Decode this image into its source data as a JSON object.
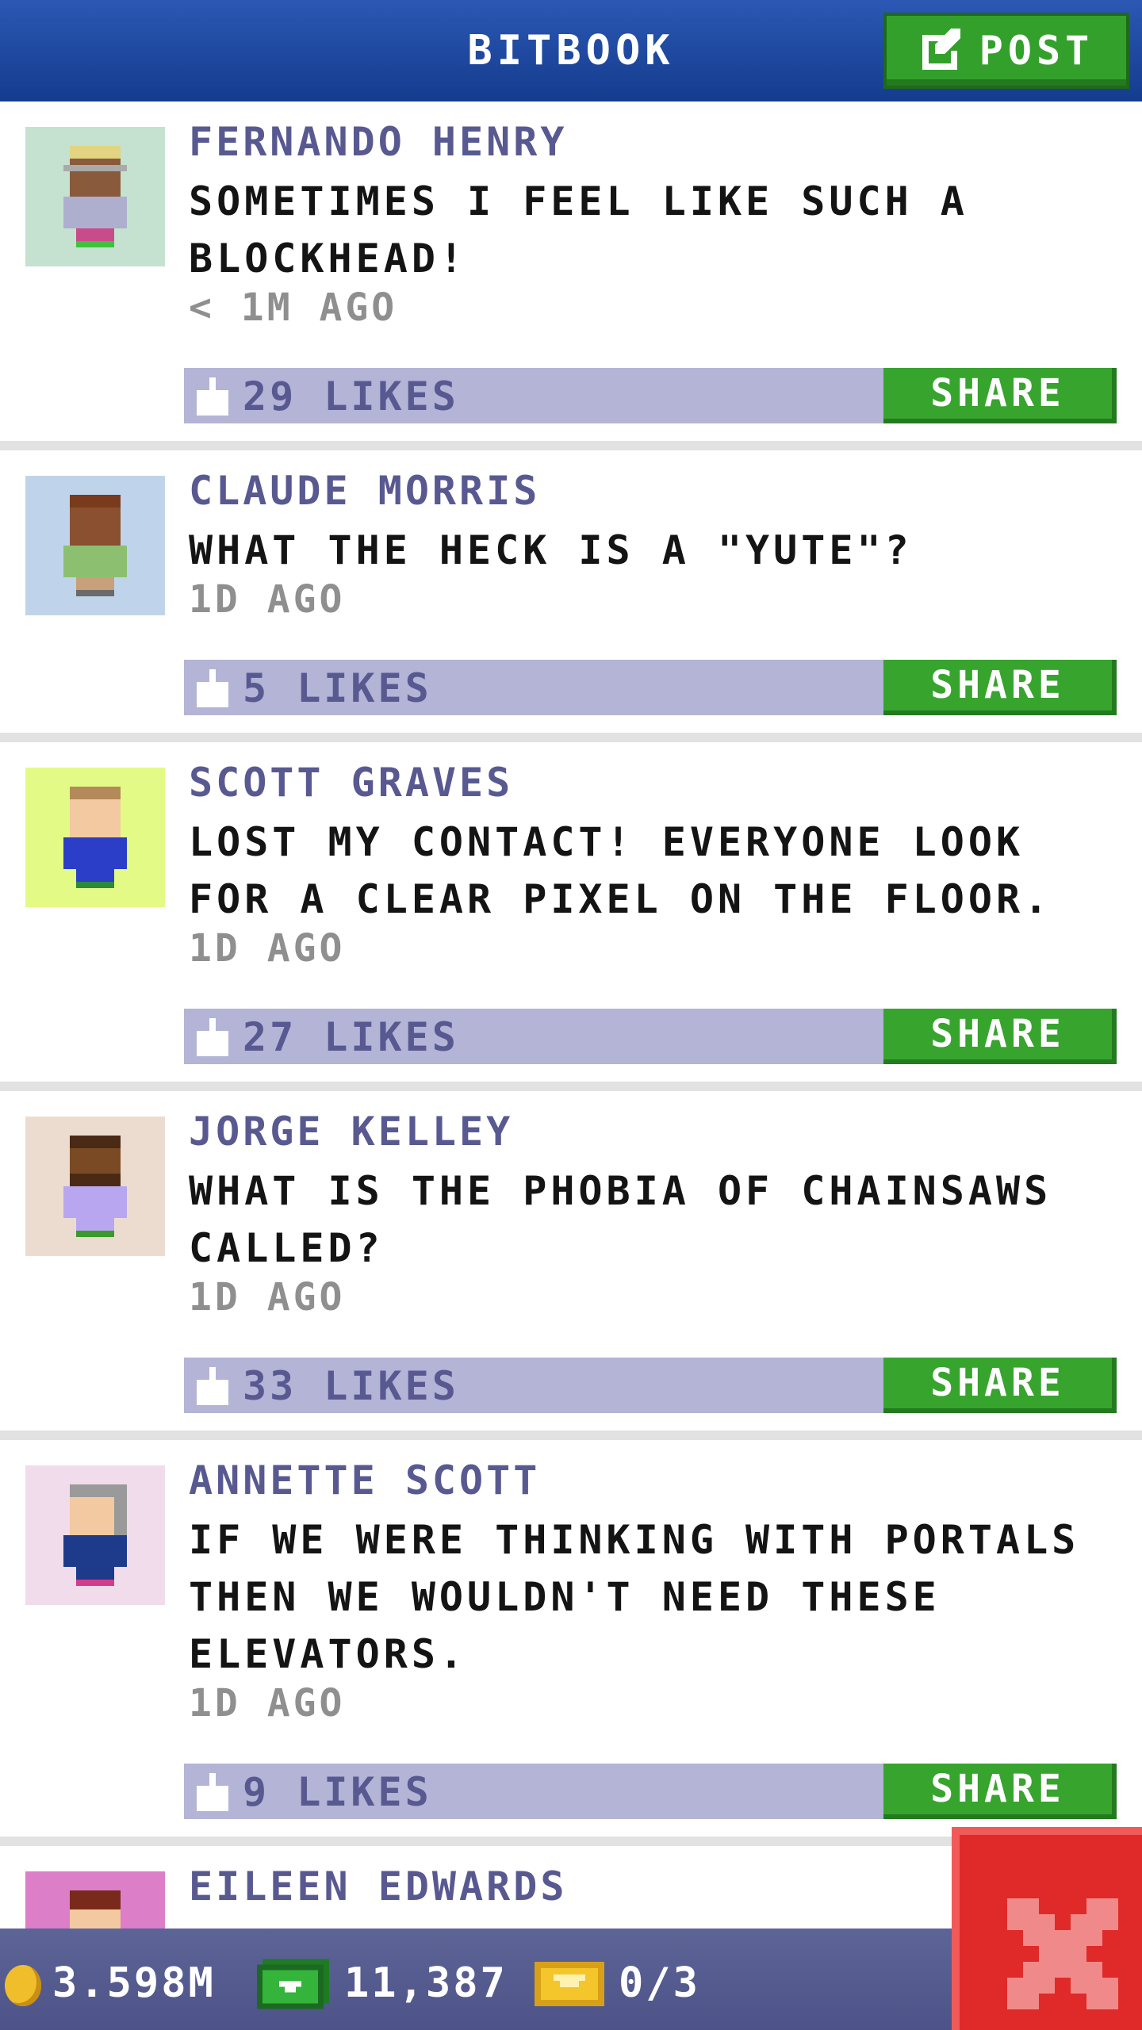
{
  "header": {
    "title": "BITBOOK",
    "post_label": "POST"
  },
  "posts": [
    {
      "name": "FERNANDO HENRY",
      "message": "SOMETIMES I FEEL LIKE SUCH A BLOCKHEAD!",
      "time": "< 1M AGO",
      "likes": "29 LIKES",
      "share_label": "SHARE"
    },
    {
      "name": "CLAUDE MORRIS",
      "message": "WHAT THE HECK IS A \"YUTE\"?",
      "time": "1D AGO",
      "likes": "5 LIKES",
      "share_label": "SHARE"
    },
    {
      "name": "SCOTT GRAVES",
      "message": "LOST MY CONTACT! EVERYONE LOOK FOR A CLEAR PIXEL ON THE FLOOR.",
      "time": "1D AGO",
      "likes": "27 LIKES",
      "share_label": "SHARE"
    },
    {
      "name": "JORGE KELLEY",
      "message": "WHAT IS THE PHOBIA OF CHAINSAWS CALLED?",
      "time": "1D AGO",
      "likes": "33 LIKES",
      "share_label": "SHARE"
    },
    {
      "name": "ANNETTE SCOTT",
      "message": "IF WE WERE THINKING WITH PORTALS THEN WE WOULDN'T NEED THESE ELEVATORS.",
      "time": "1D AGO",
      "likes": "9 LIKES",
      "share_label": "SHARE"
    },
    {
      "name": "EILEEN EDWARDS",
      "message": "",
      "time": "",
      "likes": "",
      "share_label": ""
    }
  ],
  "status": {
    "coins": "3.598M",
    "bux": "11,387",
    "tickets": "0/3"
  },
  "colors": {
    "header": "#1f4aa3",
    "name": "#595991",
    "like_bar": "#b3b4d6",
    "share": "#37a42e",
    "close": "#e02929"
  },
  "icons": [
    "edit-icon",
    "thumbs-up-icon",
    "coin-icon",
    "bux-icon",
    "ticket-icon",
    "close-icon"
  ]
}
